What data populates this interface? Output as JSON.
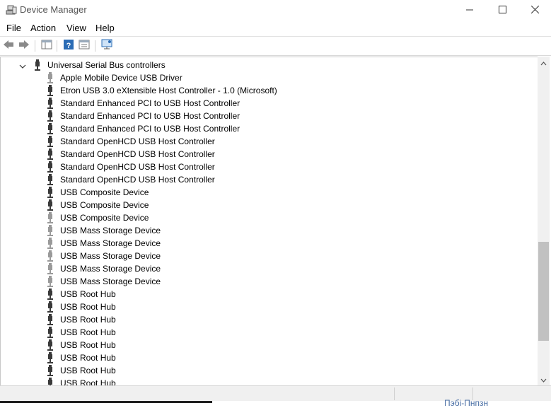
{
  "window": {
    "title": "Device Manager",
    "icons": {
      "app": "device-manager-icon",
      "minimize": "minimize-icon",
      "maximize": "maximize-icon",
      "close": "close-icon"
    }
  },
  "menu": {
    "items": [
      {
        "label": "File"
      },
      {
        "label": "Action"
      },
      {
        "label": "View"
      },
      {
        "label": "Help"
      }
    ]
  },
  "toolbar": {
    "buttons": [
      {
        "icon": "back-arrow-icon"
      },
      {
        "icon": "forward-arrow-icon"
      },
      {
        "icon": "show-hide-console-tree-icon"
      },
      {
        "icon": "help-icon"
      },
      {
        "icon": "properties-icon"
      },
      {
        "icon": "scan-hardware-changes-icon"
      }
    ]
  },
  "tree": {
    "category": {
      "label": "Universal Serial Bus controllers",
      "expanded": true,
      "icon": "usb-connector-icon"
    },
    "devices": [
      {
        "label": "Apple Mobile Device USB Driver",
        "icon": "usb-connector-icon",
        "dimmed": true
      },
      {
        "label": "Etron USB 3.0 eXtensible Host Controller - 1.0 (Microsoft)",
        "icon": "usb-connector-icon",
        "dimmed": false
      },
      {
        "label": "Standard Enhanced PCI to USB Host Controller",
        "icon": "usb-connector-icon",
        "dimmed": false
      },
      {
        "label": "Standard Enhanced PCI to USB Host Controller",
        "icon": "usb-connector-icon",
        "dimmed": false
      },
      {
        "label": "Standard Enhanced PCI to USB Host Controller",
        "icon": "usb-connector-icon",
        "dimmed": false
      },
      {
        "label": "Standard OpenHCD USB Host Controller",
        "icon": "usb-connector-icon",
        "dimmed": false
      },
      {
        "label": "Standard OpenHCD USB Host Controller",
        "icon": "usb-connector-icon",
        "dimmed": false
      },
      {
        "label": "Standard OpenHCD USB Host Controller",
        "icon": "usb-connector-icon",
        "dimmed": false
      },
      {
        "label": "Standard OpenHCD USB Host Controller",
        "icon": "usb-connector-icon",
        "dimmed": false
      },
      {
        "label": "USB Composite Device",
        "icon": "usb-connector-icon",
        "dimmed": false
      },
      {
        "label": "USB Composite Device",
        "icon": "usb-connector-icon",
        "dimmed": false
      },
      {
        "label": "USB Composite Device",
        "icon": "usb-connector-icon",
        "dimmed": true
      },
      {
        "label": "USB Mass Storage Device",
        "icon": "usb-connector-icon",
        "dimmed": true
      },
      {
        "label": "USB Mass Storage Device",
        "icon": "usb-connector-icon",
        "dimmed": true
      },
      {
        "label": "USB Mass Storage Device",
        "icon": "usb-connector-icon",
        "dimmed": true
      },
      {
        "label": "USB Mass Storage Device",
        "icon": "usb-connector-icon",
        "dimmed": true
      },
      {
        "label": "USB Mass Storage Device",
        "icon": "usb-connector-icon",
        "dimmed": true
      },
      {
        "label": "USB Root Hub",
        "icon": "usb-connector-icon",
        "dimmed": false
      },
      {
        "label": "USB Root Hub",
        "icon": "usb-connector-icon",
        "dimmed": false
      },
      {
        "label": "USB Root Hub",
        "icon": "usb-connector-icon",
        "dimmed": false
      },
      {
        "label": "USB Root Hub",
        "icon": "usb-connector-icon",
        "dimmed": false
      },
      {
        "label": "USB Root Hub",
        "icon": "usb-connector-icon",
        "dimmed": false
      },
      {
        "label": "USB Root Hub",
        "icon": "usb-connector-icon",
        "dimmed": false
      },
      {
        "label": "USB Root Hub",
        "icon": "usb-connector-icon",
        "dimmed": false
      },
      {
        "label": "USB Root Hub",
        "icon": "usb-connector-icon",
        "dimmed": false
      }
    ]
  },
  "scrollbar": {
    "up_icon": "scroll-up-arrow-icon",
    "down_icon": "scroll-down-arrow-icon"
  },
  "taskbar": {
    "partial_text": "Пэбі-Пнпзн"
  },
  "colors": {
    "text": "#000000",
    "dimmed_icon": "#9a9a9a",
    "icon": "#3a3a3a",
    "toolbar_accent": "#2b6cb5"
  }
}
